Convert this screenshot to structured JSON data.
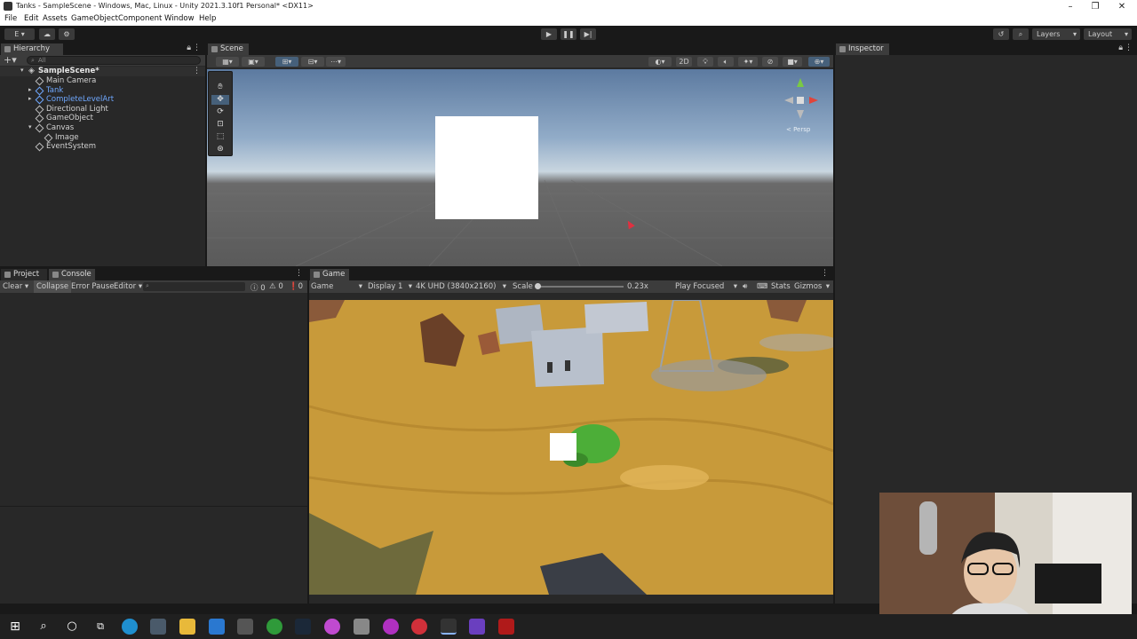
{
  "window": {
    "title": "Tanks - SampleScene - Windows, Mac, Linux - Unity 2021.3.10f1 Personal* <DX11>"
  },
  "menu": {
    "items": [
      "File",
      "Edit",
      "Assets",
      "GameObject",
      "Component",
      "Window",
      "Help"
    ]
  },
  "toolbar": {
    "account": "E",
    "layers": "Layers",
    "layout": "Layout"
  },
  "hierarchy": {
    "tab": "Hierarchy",
    "search_placeholder": "All",
    "scene": "SampleScene*",
    "items": [
      {
        "label": "Main Camera",
        "blue": false
      },
      {
        "label": "Tank",
        "blue": true
      },
      {
        "label": "CompleteLevelArt",
        "blue": true
      },
      {
        "label": "Directional Light",
        "blue": false
      },
      {
        "label": "GameObject",
        "blue": false
      },
      {
        "label": "Canvas",
        "blue": false
      },
      {
        "label": "Image",
        "blue": false
      },
      {
        "label": "EventSystem",
        "blue": false
      }
    ]
  },
  "scene": {
    "tab": "Scene",
    "mode_2d": "2D",
    "gizmo_label": "< Persp"
  },
  "inspector": {
    "tab": "Inspector"
  },
  "project": {
    "tab_project": "Project",
    "tab_console": "Console",
    "clear": "Clear",
    "collapse": "Collapse",
    "error_pause": "Error Pause",
    "editor": "Editor",
    "count_warn": "0",
    "count_err": "0",
    "count_info": "0"
  },
  "game": {
    "tab": "Game",
    "view": "Game",
    "display": "Display 1",
    "resolution": "4K UHD (3840x2160)",
    "scale_label": "Scale",
    "scale_value": "0.23x",
    "play_mode": "Play Focused",
    "stats": "Stats",
    "gizmos": "Gizmos"
  },
  "colors": {
    "accent_blue": "#6fa8ff",
    "panel_bg": "#282828",
    "sand": "#c89a3a"
  }
}
